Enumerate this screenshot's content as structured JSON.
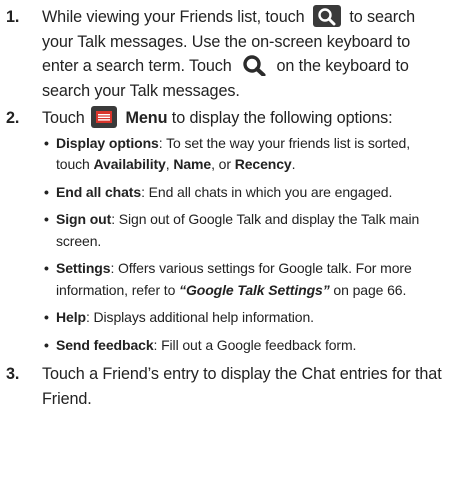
{
  "steps": [
    {
      "number": "1.",
      "text_a": "While viewing your Friends list, touch",
      "text_b": "to search your Talk messages. Use the on-screen keyboard to enter a search term. Touch",
      "text_c": "on the keyboard to search your Talk messages."
    },
    {
      "number": "2.",
      "text_a": "Touch",
      "menu_label": "Menu",
      "text_b": "to display the following options:",
      "options": [
        {
          "term": "Display options",
          "desc_a": ": To set the way your friends list is sorted, touch",
          "choice_1": "Availability",
          "sep_1": ",",
          "choice_2": "Name",
          "sep_2": ", or",
          "choice_3": "Recency",
          "end": "."
        },
        {
          "term": "End all chats",
          "desc": ": End all chats in which you are engaged."
        },
        {
          "term": "Sign out",
          "desc": ": Sign out of Google Talk and display the Talk main screen."
        },
        {
          "term": "Settings",
          "desc_a": ": Offers various settings for Google talk. For more information, refer to",
          "ref": "“Google Talk Settings”",
          "desc_b": "on page 66."
        },
        {
          "term": "Help",
          "desc": ": Displays additional help information."
        },
        {
          "term": "Send feedback",
          "desc": ": Fill out a Google feedback form."
        }
      ]
    },
    {
      "number": "3.",
      "text": "Touch a Friend’s entry to display the Chat entries for that Friend."
    }
  ],
  "bullet_glyph": "•",
  "icons": {
    "search_box": "search-icon",
    "search_plain": "search-icon",
    "menu": "menu-icon"
  },
  "colors": {
    "text": "#222222",
    "icon_dark": "#3a3a3a",
    "icon_glyph": "#ffffff",
    "menu_red": "#d9352c"
  }
}
